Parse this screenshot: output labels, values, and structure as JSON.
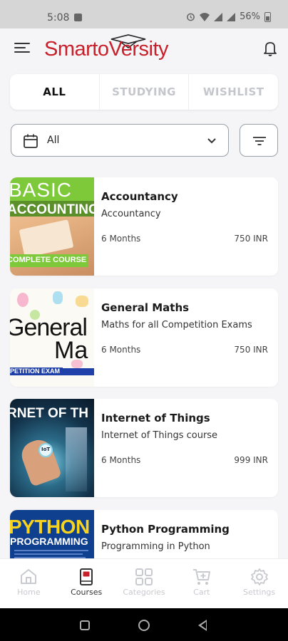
{
  "status_bar": {
    "time": "5:08",
    "battery": "56%"
  },
  "header": {
    "logo_text": "SmartoVersity"
  },
  "tabs": [
    {
      "label": "ALL",
      "active": true
    },
    {
      "label": "STUDYING",
      "active": false
    },
    {
      "label": "WISHLIST",
      "active": false
    }
  ],
  "filter": {
    "selected": "All"
  },
  "courses": [
    {
      "title": "Accountancy",
      "subtitle": "Accountancy",
      "duration": "6 Months",
      "price": "750 INR",
      "thumb_lines": [
        "BASIC",
        "ACCOUNTING",
        "COMPLETE COURSE"
      ]
    },
    {
      "title": "General Maths",
      "subtitle": "Maths for all Competition Exams",
      "duration": "6 Months",
      "price": "750 INR",
      "thumb_lines": [
        "General",
        "Ma",
        "PETITION EXAM"
      ]
    },
    {
      "title": "Internet of Things",
      "subtitle": "Internet of Things course",
      "duration": "6 Months",
      "price": "999 INR",
      "thumb_lines": [
        "RNET OF TH",
        "IoT"
      ]
    },
    {
      "title": "Python Programming",
      "subtitle": "Programming in Python",
      "duration": "",
      "price": "",
      "thumb_lines": [
        "PYTHON",
        "PROGRAMMING"
      ]
    }
  ],
  "bottom_nav": [
    {
      "label": "Home",
      "icon": "home-icon",
      "active": false
    },
    {
      "label": "Courses",
      "icon": "book-icon",
      "active": true
    },
    {
      "label": "Categories",
      "icon": "grid-icon",
      "active": false
    },
    {
      "label": "Cart",
      "icon": "cart-icon",
      "active": false
    },
    {
      "label": "Settings",
      "icon": "gear-icon",
      "active": false
    }
  ],
  "colors": {
    "brand": "#c8202b",
    "active_text": "#111111",
    "inactive_text": "#c4c6cc",
    "background": "#f5f5f7"
  }
}
